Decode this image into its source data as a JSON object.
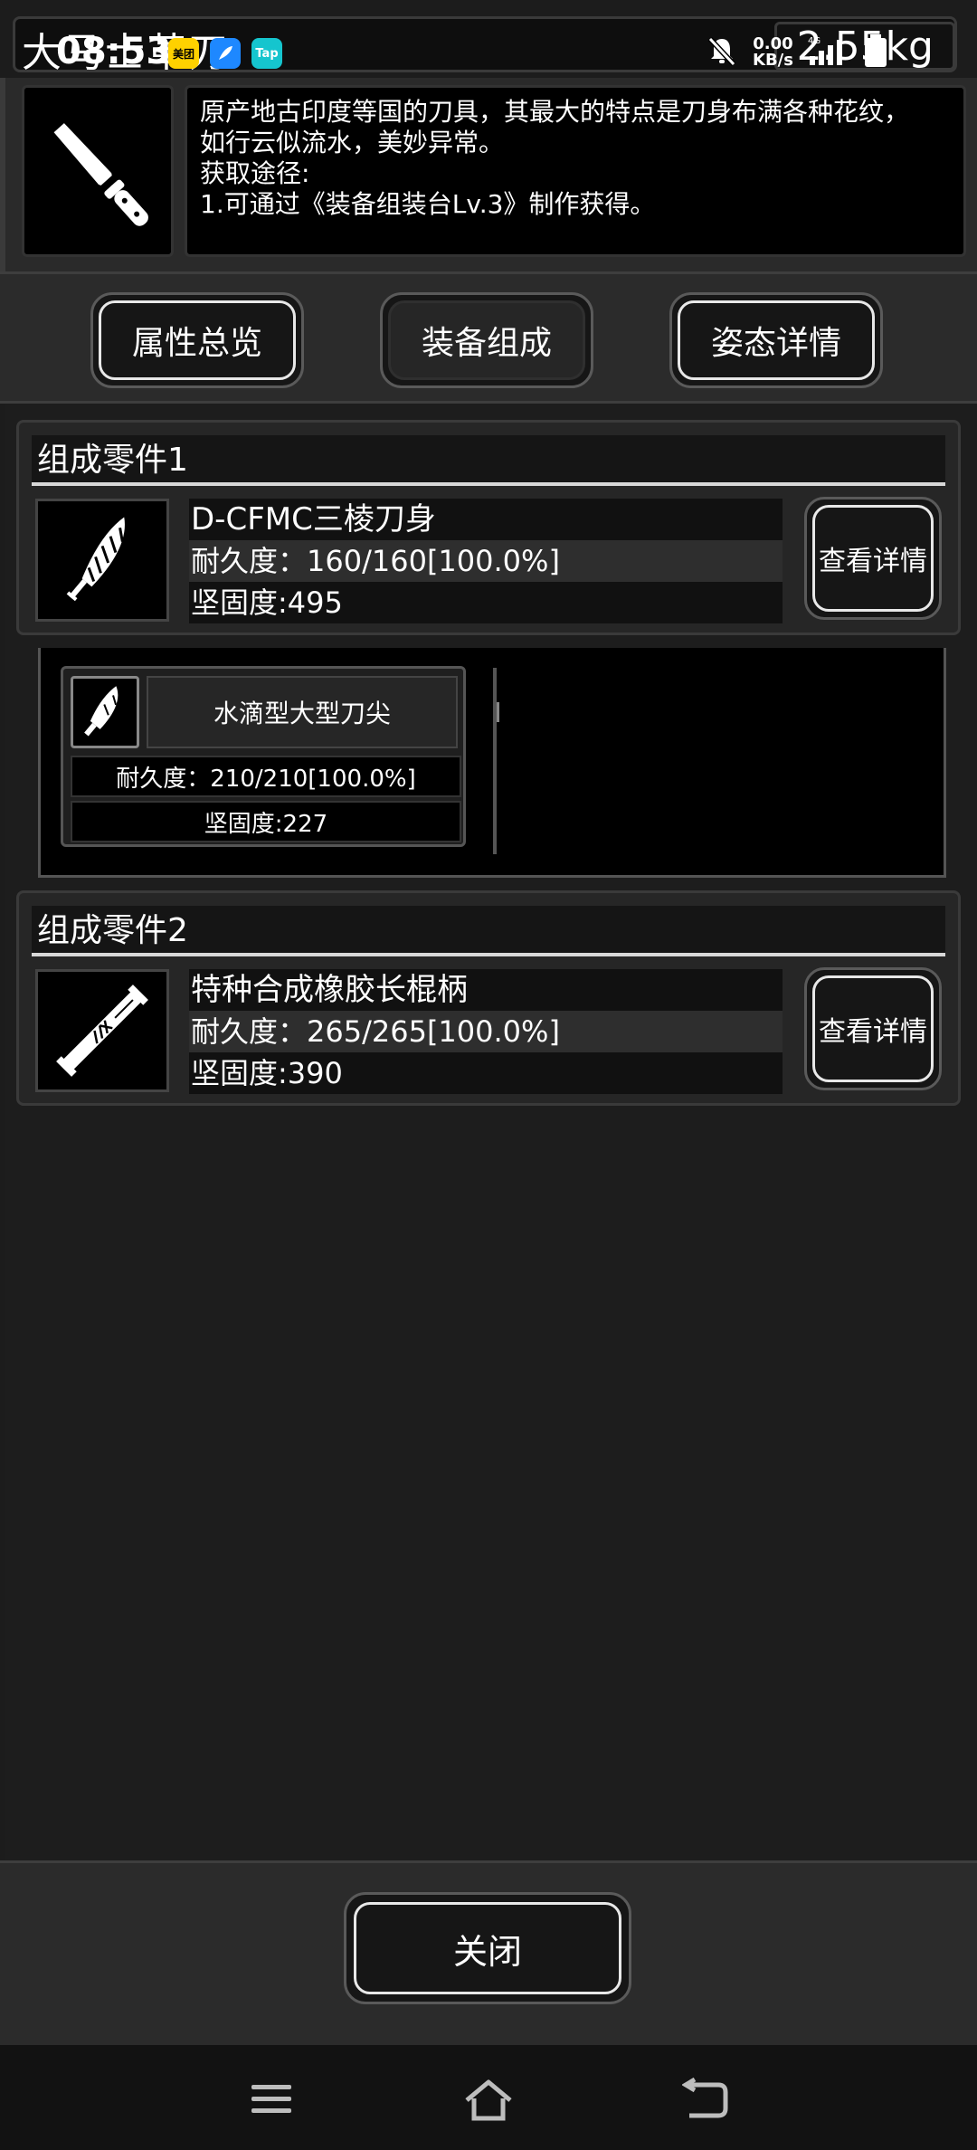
{
  "status_bar": {
    "time": "08:53",
    "net_speed_value": "0.00",
    "net_speed_unit": "KB/s",
    "network_type": "4G",
    "app_icons": [
      "美团",
      "",
      "Tap"
    ]
  },
  "header": {
    "item_name": "大马士革刀",
    "weight": "2.55kg"
  },
  "description": {
    "lines": [
      "原产地古印度等国的刀具，其最大的特点是刀身布满各种花纹，",
      "如行云似流水，美妙异常。",
      "获取途径:",
      "1.可通过《装备组装台Lv.3》制作获得。"
    ]
  },
  "tabs": {
    "overview": "属性总览",
    "composition": "装备组成",
    "stance": "姿态详情"
  },
  "parts": [
    {
      "section_title": "组成零件1",
      "name": "D-CFMC三棱刀身",
      "durability": "耐久度：160/160[100.0%]",
      "hardness": "坚固度:495",
      "detail_label": "查看详情"
    },
    {
      "section_title": "组成零件2",
      "name": "特种合成橡胶长棍柄",
      "durability": "耐久度：265/265[100.0%]",
      "hardness": "坚固度:390",
      "detail_label": "查看详情"
    }
  ],
  "subpart": {
    "name": "水滴型大型刀尖",
    "durability": "耐久度：210/210[100.0%]",
    "hardness": "坚固度:227"
  },
  "close_label": "关闭",
  "colors": {
    "background": "#1c1c1c",
    "panel": "#262626",
    "accent_border": "#e8e8e8",
    "meituan_yellow": "#ffd100",
    "tap_teal": "#15c5ce",
    "blue_app": "#1e88ff"
  }
}
